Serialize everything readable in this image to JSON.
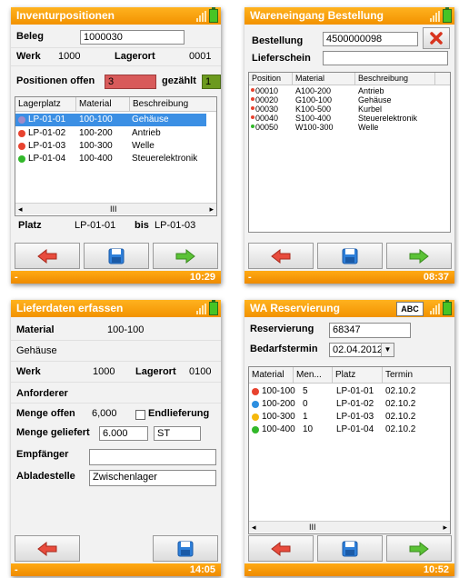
{
  "colors": {
    "title_bar": "#f29200",
    "selection": "#3b8fe4",
    "arrow_red": "#e84c3d",
    "arrow_green": "#5bc236",
    "save_blue": "#2e7fd9",
    "dot_purple": "#a08ac8",
    "dot_red": "#e8432f",
    "dot_green": "#32b82a",
    "dot_blue": "#2d8fe0",
    "dot_yellow": "#f5b80c"
  },
  "screen1": {
    "title": "Inventurpositionen",
    "beleg_label": "Beleg",
    "beleg_value": "1000030",
    "werk_label": "Werk",
    "werk_value": "1000",
    "lagerort_label": "Lagerort",
    "lagerort_value": "0001",
    "offen_label": "Positionen offen",
    "offen_value": "3",
    "gezaehlt_label": "gezählt",
    "gezaehlt_value": "1",
    "columns": [
      "Lagerplatz",
      "Material",
      "Beschreibung"
    ],
    "rows": [
      {
        "platz": "LP-01-01",
        "material": "100-100",
        "beschreibung": "Gehäuse",
        "status": "purple",
        "selected": true
      },
      {
        "platz": "LP-01-02",
        "material": "100-200",
        "beschreibung": "Antrieb",
        "status": "red",
        "selected": false
      },
      {
        "platz": "LP-01-03",
        "material": "100-300",
        "beschreibung": "Welle",
        "status": "red",
        "selected": false
      },
      {
        "platz": "LP-01-04",
        "material": "100-400",
        "beschreibung": "Steuerelektronik",
        "status": "green",
        "selected": false
      }
    ],
    "scroll_thumb": "III",
    "platz_label": "Platz",
    "platz_value": "LP-01-01",
    "bis_label": "bis",
    "bis_value": "LP-01-03",
    "status_left": "-",
    "time": "10:29",
    "icons": {
      "back": "arrow-left-icon",
      "save": "save-icon",
      "forward": "arrow-right-icon"
    }
  },
  "screen2": {
    "title": "Wareneingang Bestellung",
    "bestellung_label": "Bestellung",
    "bestellung_value": "4500000098",
    "lieferschein_label": "Lieferschein",
    "lieferschein_value": "",
    "columns": [
      "Position",
      "Material",
      "Beschreibung"
    ],
    "rows": [
      {
        "position": "00010",
        "material": "A100-200",
        "beschreibung": "Antrieb",
        "status": "red"
      },
      {
        "position": "00020",
        "material": "G100-100",
        "beschreibung": "Gehäuse",
        "status": "red"
      },
      {
        "position": "00030",
        "material": "K100-500",
        "beschreibung": "Kurbel",
        "status": "red"
      },
      {
        "position": "00040",
        "material": "S100-400",
        "beschreibung": "Steuerelektronik",
        "status": "red"
      },
      {
        "position": "00050",
        "material": "W100-300",
        "beschreibung": "Welle",
        "status": "green"
      }
    ],
    "status_left": "-",
    "time": "08:37"
  },
  "screen3": {
    "title": "Lieferdaten erfassen",
    "material_label": "Material",
    "material_value": "100-100",
    "material_desc": "Gehäuse",
    "werk_label": "Werk",
    "werk_value": "1000",
    "lagerort_label": "Lagerort",
    "lagerort_value": "0100",
    "anforderer_label": "Anforderer",
    "menge_offen_label": "Menge offen",
    "menge_offen_value": "6,000",
    "endlieferung_label": "Endlieferung",
    "menge_geliefert_label": "Menge geliefert",
    "menge_geliefert_value": "6.000",
    "unit_value": "ST",
    "empfaenger_label": "Empfänger",
    "empfaenger_value": "",
    "abladestelle_label": "Abladestelle",
    "abladestelle_value": "Zwischenlager",
    "status_left": "-",
    "time": "14:05"
  },
  "screen4": {
    "title": "WA Reservierung",
    "abc_label": "ABC",
    "reservierung_label": "Reservierung",
    "reservierung_value": "68347",
    "bedarfstermin_label": "Bedarfstermin",
    "bedarfstermin_value": "02.04.2012",
    "columns": [
      "Material",
      "Men...",
      "Platz",
      "Termin"
    ],
    "rows": [
      {
        "material": "100-100",
        "menge": "5",
        "platz": "LP-01-01",
        "termin": "02.10.2",
        "status": "red"
      },
      {
        "material": "100-200",
        "menge": "0",
        "platz": "LP-01-02",
        "termin": "02.10.2",
        "status": "blue"
      },
      {
        "material": "100-300",
        "menge": "1",
        "platz": "LP-01-03",
        "termin": "02.10.2",
        "status": "yellow"
      },
      {
        "material": "100-400",
        "menge": "10",
        "platz": "LP-01-04",
        "termin": "02.10.2",
        "status": "green"
      }
    ],
    "scroll_thumb": "III",
    "status_left": "-",
    "time": "10:52"
  }
}
